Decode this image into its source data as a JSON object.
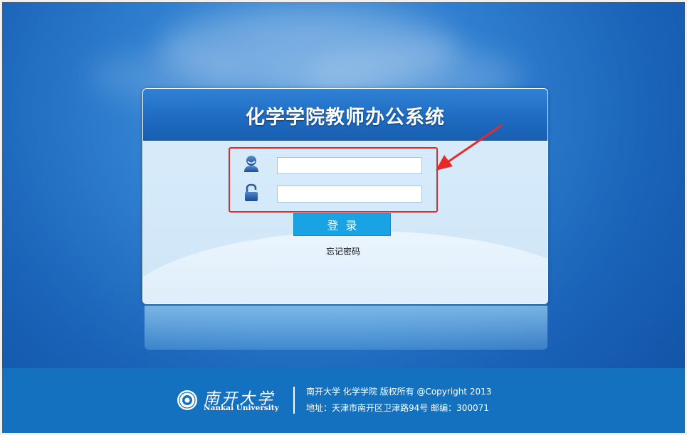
{
  "panel": {
    "title": "化学学院教师办公系统"
  },
  "login_form": {
    "username": {
      "value": "",
      "icon": "user-icon"
    },
    "password": {
      "value": "",
      "icon": "lock-icon"
    },
    "login_label": "登录",
    "forgot_password_label": "忘记密码"
  },
  "footer": {
    "logo_cn": "南开大学",
    "logo_en": "Nankai University",
    "copyright": "南开大学 化学学院 版权所有 @Copyright 2013",
    "address": "地址：天津市南开区卫津路94号 邮编：300071"
  },
  "colors": {
    "accent": "#1aa3e4",
    "header_blue": "#1f6cc2",
    "footer_blue": "#1471bf",
    "annotation_red": "#e62a2a"
  }
}
